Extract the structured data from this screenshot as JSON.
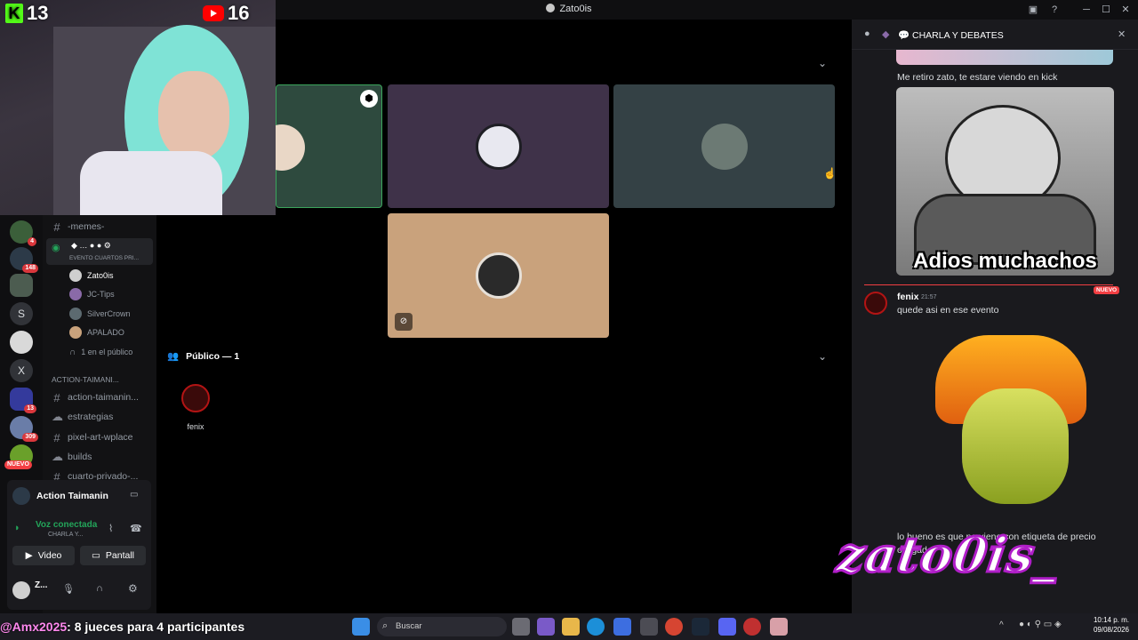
{
  "window": {
    "title": "Zato0is"
  },
  "overlay": {
    "kick_count": "13",
    "youtube_count": "16",
    "ticker": ": 8 jueces para 4 participantes",
    "ticker_user": "@Amx2025",
    "watermark": "zato0is_"
  },
  "servers": [
    {
      "badge": "4"
    },
    {
      "badge": "148"
    },
    {
      "badge": ""
    },
    {
      "letter": "S"
    },
    {
      "badge": ""
    },
    {
      "letter": "X"
    },
    {
      "badge": "13"
    },
    {
      "badge": "309"
    },
    {
      "badge": "NUEVO"
    }
  ],
  "channels": {
    "memes": "-memes-",
    "event_label": "EVENTO CUARTOS PRI...",
    "voice_users": [
      "Zato0is",
      "JC-Tips",
      "SilverCrown",
      "APALADO"
    ],
    "audience": "1 en el público",
    "category": "ACTION-TAIMANI...",
    "list": [
      "action-taimanin...",
      "estrategias",
      "pixel-art-wplace",
      "builds",
      "cuarto-privado-..."
    ]
  },
  "user_panel": {
    "server_name": "Action Taimanin",
    "voice_status": "Voz conectada",
    "voice_channel": "CHARLA Y...",
    "video_btn": "Video",
    "screen_btn": "Pantall",
    "username": "Z..."
  },
  "stage": {
    "audience_header": "Público — 1",
    "audience_member": "fenix"
  },
  "chat": {
    "header": "CHARLA Y DEBATES",
    "msg1": "Me retiro zato, te estare viendo en kick",
    "meme_caption": "Adios muchachos",
    "new_tag": "NUEVO",
    "author": "fenix",
    "time": "21:57",
    "msg2": "quede asi en ese evento",
    "msg3": "lo bueno es que no viene con etiqueta de precio",
    "msg3b": "obligado"
  },
  "taskbar": {
    "search": "Buscar",
    "time": "10:14 p. m.",
    "date": "09/08/2026"
  },
  "colors": {
    "accent": "#5865f2",
    "voice_green": "#23a55a",
    "danger": "#f23f43",
    "kick": "#53fc18"
  }
}
